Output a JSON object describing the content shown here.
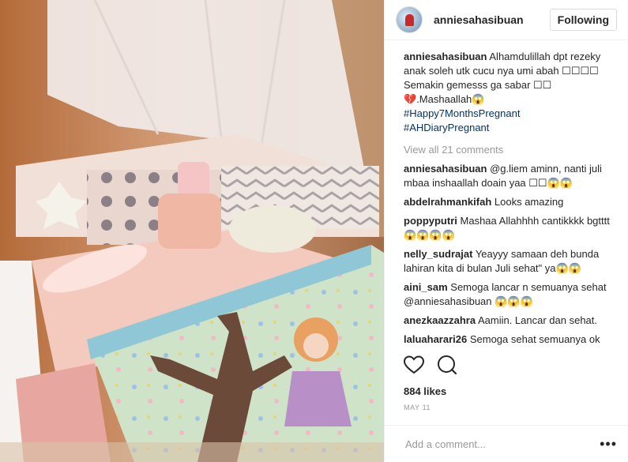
{
  "post": {
    "username": "anniesahasibuan",
    "follow_label": "Following",
    "caption_text": "Alhamdulillah dpt rezeky anak soleh utk cucu nya umi abah ☐☐☐☐ Semakin gemesss ga sabar ☐☐ 💔.Mashaallah😱",
    "hashtags": [
      "#Happy7MonthsPregnant",
      "#AHDiaryPregnant"
    ],
    "view_all": "View all 21 comments",
    "comments": [
      {
        "user": "anniesahasibuan",
        "text": "@g.liem aminn, nanti juli mbaa inshaallah doain yaa ☐☐😱😱"
      },
      {
        "user": "abdelrahmankifah",
        "text": "Looks amazing"
      },
      {
        "user": "poppyputri",
        "text": "Mashaa Allahhhh cantikkkk bgtttt 😱😱😱😱"
      },
      {
        "user": "nelly_sudrajat",
        "text": "Yeayyy samaan deh bunda lahiran kita di bulan Juli sehat\" ya😱😱"
      },
      {
        "user": "aini_sam",
        "text": "Semoga lancar n semuanya sehat @anniesahasibuan 😱😱😱"
      },
      {
        "user": "anezkaazzahra",
        "text": "Aamiin. Lancar dan sehat."
      },
      {
        "user": "laluaharari26",
        "text": "Semoga sehat semuanya ok"
      }
    ],
    "likes": "884 likes",
    "date": "MAY 11",
    "add_comment_placeholder": "Add a comment...",
    "more_label": "•••"
  },
  "icons": {
    "like": "heart-icon",
    "comment": "comment-icon",
    "more": "more-options-icon"
  },
  "colors": {
    "accent_link": "#003569",
    "muted": "#999999",
    "text": "#262626"
  }
}
